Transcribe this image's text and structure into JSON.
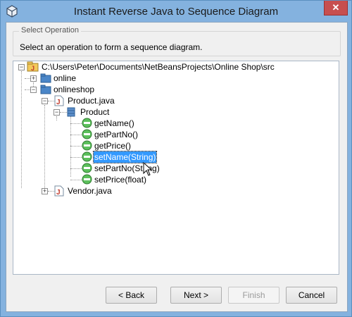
{
  "window": {
    "title": "Instant Reverse Java to Sequence Diagram",
    "close_glyph": "✕"
  },
  "group": {
    "legend": "Select Operation",
    "instruction": "Select an operation to form a sequence diagram."
  },
  "tree": {
    "root": "C:\\Users\\Peter\\Documents\\NetBeansProjects\\Online Shop\\src",
    "pkg_online": "online",
    "pkg_onlineshop": "onlineshop",
    "file_product": "Product.java",
    "class_product": "Product",
    "ops": [
      "getName()",
      "getPartNo()",
      "getPrice()",
      "setName(String)",
      "setPartNo(String)",
      "setPrice(float)"
    ],
    "selected_op": "setName(String)",
    "file_vendor": "Vendor.java"
  },
  "buttons": {
    "back": "< Back",
    "next": "Next >",
    "finish": "Finish",
    "cancel": "Cancel"
  },
  "icons": {
    "root": "package-root-icon",
    "package": "package-icon",
    "java_file": "java-file-icon",
    "class": "class-icon",
    "operation": "operation-icon"
  }
}
